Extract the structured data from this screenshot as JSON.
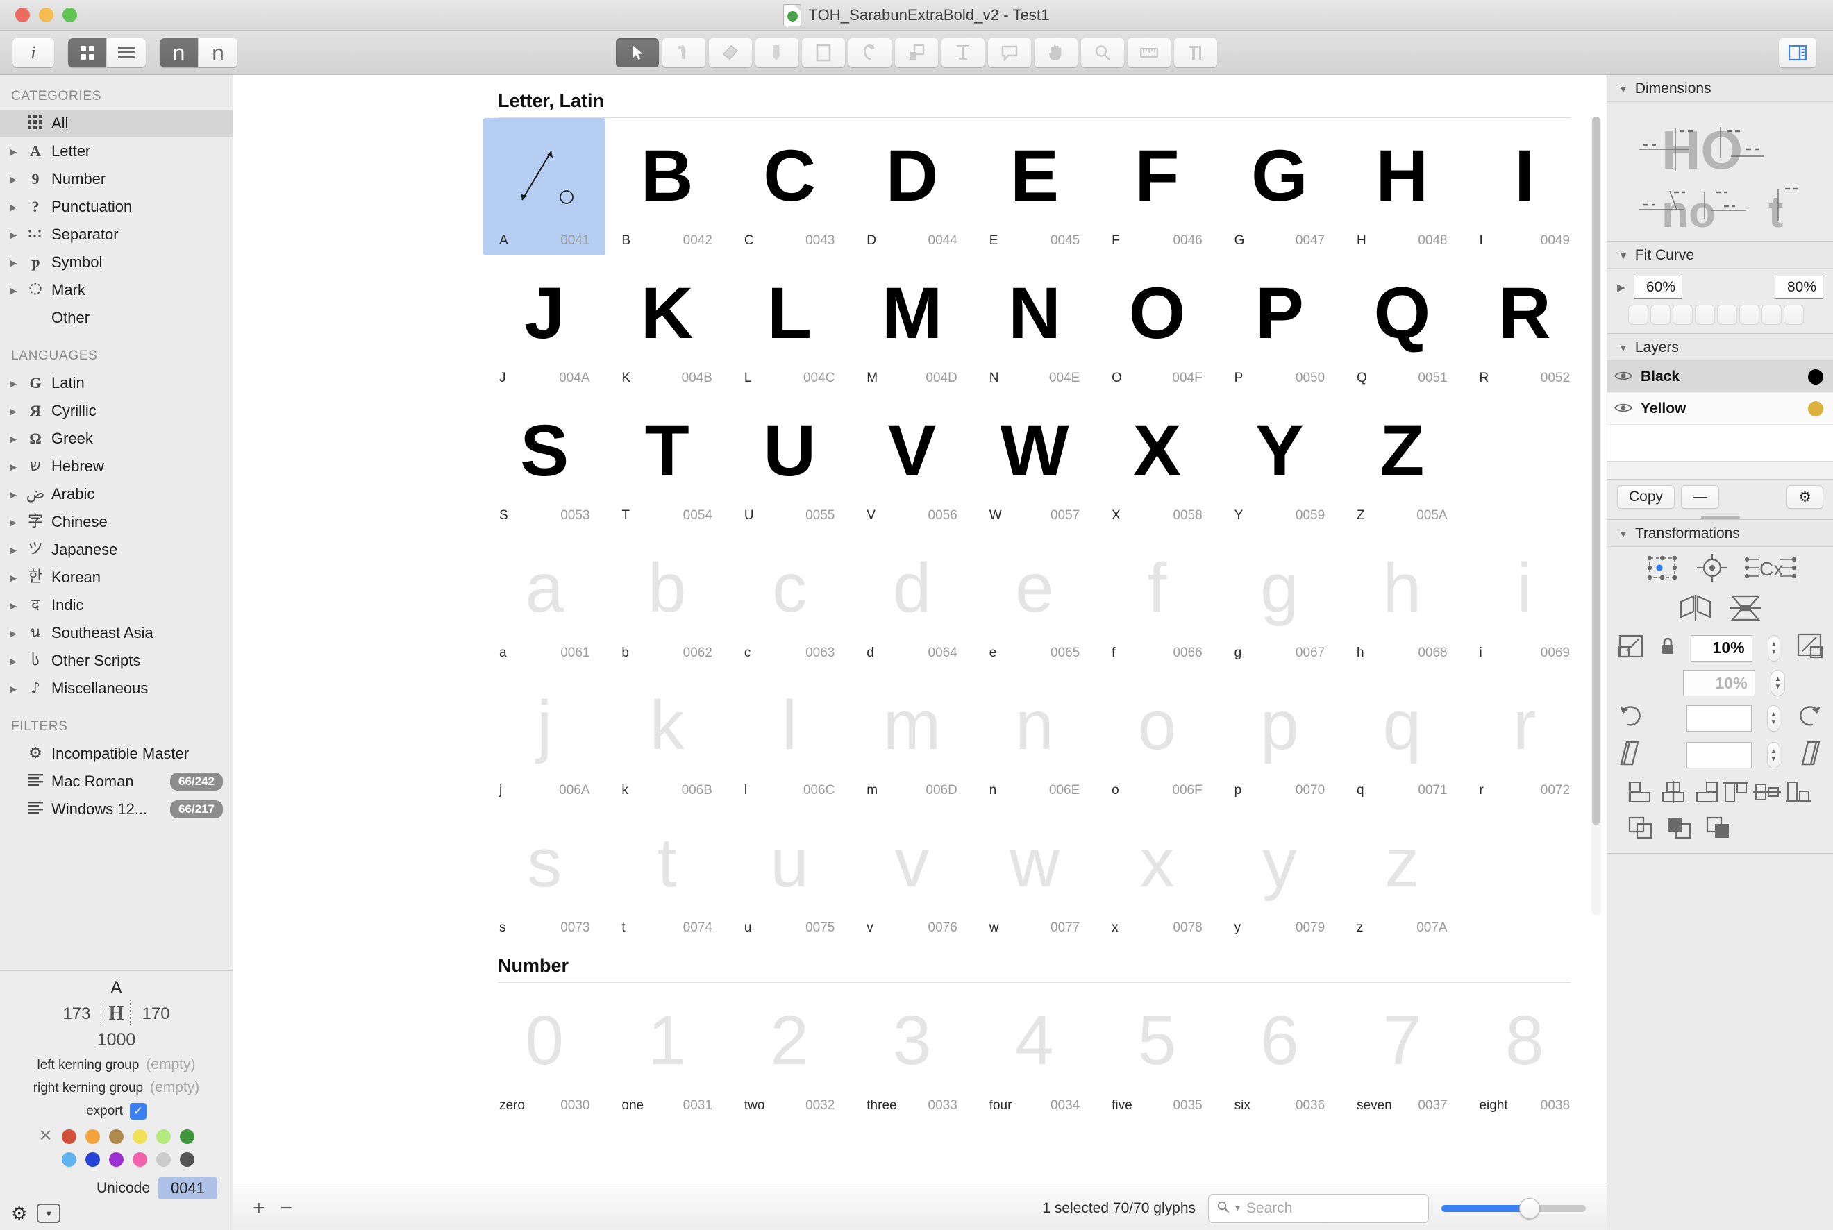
{
  "window": {
    "title": "TOH_SarabunExtraBold_v2 - Test1",
    "doc_icon": "font-document-icon"
  },
  "toolbar": {
    "info_label": "i",
    "view_grid_icon": "grid-view-icon",
    "view_list_icon": "list-view-icon",
    "font_view_label": "n",
    "text_view_label": "n",
    "tools": [
      {
        "name": "select-tool",
        "icon": "arrow-cursor-icon",
        "active": true
      },
      {
        "name": "draw-tool",
        "icon": "pen-icon",
        "active": false
      },
      {
        "name": "knife-tool",
        "icon": "knife-icon",
        "active": false
      },
      {
        "name": "pencil-tool",
        "icon": "pencil-icon",
        "active": false
      },
      {
        "name": "primitives-tool",
        "icon": "rectangle-icon",
        "active": false
      },
      {
        "name": "rotate-tool",
        "icon": "rotate-icon",
        "active": false
      },
      {
        "name": "scale-tool",
        "icon": "scale-shapes-icon",
        "active": false
      },
      {
        "name": "text-tool",
        "icon": "text-t-icon",
        "active": false
      },
      {
        "name": "annotation-tool",
        "icon": "speech-bubble-icon",
        "active": false
      },
      {
        "name": "hand-tool",
        "icon": "hand-icon",
        "active": false
      },
      {
        "name": "zoom-tool",
        "icon": "magnifier-icon",
        "active": false
      },
      {
        "name": "measurement-tool",
        "icon": "ruler-icon",
        "active": false
      },
      {
        "name": "vertical-text-tool",
        "icon": "vertical-text-icon",
        "active": false
      }
    ],
    "sidebar_toggle_icon": "inspector-toggle-icon"
  },
  "sidebar": {
    "categories_header": "CATEGORIES",
    "categories": [
      {
        "label": "All",
        "icon": "all-glyphs-icon",
        "expandable": false,
        "selected": true
      },
      {
        "label": "Letter",
        "icon": "letter-A-icon",
        "expandable": true,
        "selected": false
      },
      {
        "label": "Number",
        "icon": "number-9-icon",
        "expandable": true,
        "selected": false
      },
      {
        "label": "Punctuation",
        "icon": "question-mark-icon",
        "expandable": true,
        "selected": false
      },
      {
        "label": "Separator",
        "icon": "separator-dots-icon",
        "expandable": true,
        "selected": false
      },
      {
        "label": "Symbol",
        "icon": "pilcrow-icon",
        "expandable": true,
        "selected": false
      },
      {
        "label": "Mark",
        "icon": "dotted-circle-icon",
        "expandable": true,
        "selected": false
      },
      {
        "label": "Other",
        "icon": "",
        "expandable": false,
        "selected": false
      }
    ],
    "languages_header": "LANGUAGES",
    "languages": [
      {
        "label": "Latin",
        "icon": "latin-G-icon"
      },
      {
        "label": "Cyrillic",
        "icon": "cyrillic-ya-icon"
      },
      {
        "label": "Greek",
        "icon": "greek-omega-icon"
      },
      {
        "label": "Hebrew",
        "icon": "hebrew-shin-icon"
      },
      {
        "label": "Arabic",
        "icon": "arabic-dad-icon"
      },
      {
        "label": "Chinese",
        "icon": "chinese-zi-icon"
      },
      {
        "label": "Japanese",
        "icon": "japanese-tsu-icon"
      },
      {
        "label": "Korean",
        "icon": "korean-han-icon"
      },
      {
        "label": "Indic",
        "icon": "devanagari-de-icon"
      },
      {
        "label": "Southeast Asia",
        "icon": "thai-icon"
      },
      {
        "label": "Other Scripts",
        "icon": "other-script-icon"
      },
      {
        "label": "Miscellaneous",
        "icon": "music-note-icon"
      }
    ],
    "filters_header": "FILTERS",
    "filters": [
      {
        "label": "Incompatible Master",
        "icon": "gear-icon",
        "badge": ""
      },
      {
        "label": "Mac Roman",
        "icon": "list-lines-icon",
        "badge": "66/242"
      },
      {
        "label": "Windows 12...",
        "icon": "list-lines-icon",
        "badge": "66/217"
      }
    ]
  },
  "glyph_info": {
    "char": "A",
    "left_sidebearing": "173",
    "right_sidebearing": "170",
    "preview_letter": "H",
    "width": "1000",
    "left_kerning_label": "left kerning group",
    "left_kerning_value": "(empty)",
    "right_kerning_label": "right kerning group",
    "right_kerning_value": "(empty)",
    "export_label": "export",
    "export_checked": true,
    "check_glyph": "✓",
    "colors_row1": [
      "#d24f38",
      "#f2a33c",
      "#ae8a4c",
      "#f2e154",
      "#b5eb7e",
      "#41953a"
    ],
    "colors_row2": [
      "#5fb4f0",
      "#2743d6",
      "#9b2fd1",
      "#f062ab",
      "#cccccc",
      "#555555"
    ],
    "clear_color_icon": "x-clear-icon",
    "unicode_label": "Unicode",
    "unicode_value": "0041",
    "gear_icon": "gear-icon",
    "popup_icon": "popup-menu-icon"
  },
  "grid": {
    "sections": [
      {
        "title": "Letter, Latin",
        "rows": [
          [
            {
              "char": "A",
              "name": "A",
              "code": "0041",
              "selected": true,
              "faint": false,
              "blank": true
            },
            {
              "char": "B",
              "name": "B",
              "code": "0042",
              "selected": false,
              "faint": false
            },
            {
              "char": "C",
              "name": "C",
              "code": "0043",
              "selected": false,
              "faint": false
            },
            {
              "char": "D",
              "name": "D",
              "code": "0044",
              "selected": false,
              "faint": false
            },
            {
              "char": "E",
              "name": "E",
              "code": "0045",
              "selected": false,
              "faint": false
            },
            {
              "char": "F",
              "name": "F",
              "code": "0046",
              "selected": false,
              "faint": false
            },
            {
              "char": "G",
              "name": "G",
              "code": "0047",
              "selected": false,
              "faint": false
            },
            {
              "char": "H",
              "name": "H",
              "code": "0048",
              "selected": false,
              "faint": false
            },
            {
              "char": "I",
              "name": "I",
              "code": "0049",
              "selected": false,
              "faint": false
            }
          ],
          [
            {
              "char": "J",
              "name": "J",
              "code": "004A",
              "selected": false,
              "faint": false
            },
            {
              "char": "K",
              "name": "K",
              "code": "004B",
              "selected": false,
              "faint": false
            },
            {
              "char": "L",
              "name": "L",
              "code": "004C",
              "selected": false,
              "faint": false
            },
            {
              "char": "M",
              "name": "M",
              "code": "004D",
              "selected": false,
              "faint": false
            },
            {
              "char": "N",
              "name": "N",
              "code": "004E",
              "selected": false,
              "faint": false
            },
            {
              "char": "O",
              "name": "O",
              "code": "004F",
              "selected": false,
              "faint": false
            },
            {
              "char": "P",
              "name": "P",
              "code": "0050",
              "selected": false,
              "faint": false
            },
            {
              "char": "Q",
              "name": "Q",
              "code": "0051",
              "selected": false,
              "faint": false
            },
            {
              "char": "R",
              "name": "R",
              "code": "0052",
              "selected": false,
              "faint": false
            }
          ],
          [
            {
              "char": "S",
              "name": "S",
              "code": "0053",
              "selected": false,
              "faint": false
            },
            {
              "char": "T",
              "name": "T",
              "code": "0054",
              "selected": false,
              "faint": false
            },
            {
              "char": "U",
              "name": "U",
              "code": "0055",
              "selected": false,
              "faint": false
            },
            {
              "char": "V",
              "name": "V",
              "code": "0056",
              "selected": false,
              "faint": false
            },
            {
              "char": "W",
              "name": "W",
              "code": "0057",
              "selected": false,
              "faint": false
            },
            {
              "char": "X",
              "name": "X",
              "code": "0058",
              "selected": false,
              "faint": false
            },
            {
              "char": "Y",
              "name": "Y",
              "code": "0059",
              "selected": false,
              "faint": false
            },
            {
              "char": "Z",
              "name": "Z",
              "code": "005A",
              "selected": false,
              "faint": false
            },
            {
              "char": "",
              "name": "",
              "code": "",
              "selected": false,
              "faint": false,
              "empty": true
            }
          ],
          [
            {
              "char": "a",
              "name": "a",
              "code": "0061",
              "selected": false,
              "faint": true
            },
            {
              "char": "b",
              "name": "b",
              "code": "0062",
              "selected": false,
              "faint": true
            },
            {
              "char": "c",
              "name": "c",
              "code": "0063",
              "selected": false,
              "faint": true
            },
            {
              "char": "d",
              "name": "d",
              "code": "0064",
              "selected": false,
              "faint": true
            },
            {
              "char": "e",
              "name": "e",
              "code": "0065",
              "selected": false,
              "faint": true
            },
            {
              "char": "f",
              "name": "f",
              "code": "0066",
              "selected": false,
              "faint": true
            },
            {
              "char": "g",
              "name": "g",
              "code": "0067",
              "selected": false,
              "faint": true
            },
            {
              "char": "h",
              "name": "h",
              "code": "0068",
              "selected": false,
              "faint": true
            },
            {
              "char": "i",
              "name": "i",
              "code": "0069",
              "selected": false,
              "faint": true
            }
          ],
          [
            {
              "char": "j",
              "name": "j",
              "code": "006A",
              "selected": false,
              "faint": true
            },
            {
              "char": "k",
              "name": "k",
              "code": "006B",
              "selected": false,
              "faint": true
            },
            {
              "char": "l",
              "name": "l",
              "code": "006C",
              "selected": false,
              "faint": true
            },
            {
              "char": "m",
              "name": "m",
              "code": "006D",
              "selected": false,
              "faint": true
            },
            {
              "char": "n",
              "name": "n",
              "code": "006E",
              "selected": false,
              "faint": true
            },
            {
              "char": "o",
              "name": "o",
              "code": "006F",
              "selected": false,
              "faint": true
            },
            {
              "char": "p",
              "name": "p",
              "code": "0070",
              "selected": false,
              "faint": true
            },
            {
              "char": "q",
              "name": "q",
              "code": "0071",
              "selected": false,
              "faint": true
            },
            {
              "char": "r",
              "name": "r",
              "code": "0072",
              "selected": false,
              "faint": true
            }
          ],
          [
            {
              "char": "s",
              "name": "s",
              "code": "0073",
              "selected": false,
              "faint": true
            },
            {
              "char": "t",
              "name": "t",
              "code": "0074",
              "selected": false,
              "faint": true
            },
            {
              "char": "u",
              "name": "u",
              "code": "0075",
              "selected": false,
              "faint": true
            },
            {
              "char": "v",
              "name": "v",
              "code": "0076",
              "selected": false,
              "faint": true
            },
            {
              "char": "w",
              "name": "w",
              "code": "0077",
              "selected": false,
              "faint": true
            },
            {
              "char": "x",
              "name": "x",
              "code": "0078",
              "selected": false,
              "faint": true
            },
            {
              "char": "y",
              "name": "y",
              "code": "0079",
              "selected": false,
              "faint": true
            },
            {
              "char": "z",
              "name": "z",
              "code": "007A",
              "selected": false,
              "faint": true
            },
            {
              "char": "",
              "name": "",
              "code": "",
              "selected": false,
              "faint": false,
              "empty": true
            }
          ]
        ]
      },
      {
        "title": "Number",
        "rows": [
          [
            {
              "char": "0",
              "name": "zero",
              "code": "0030",
              "selected": false,
              "faint": true
            },
            {
              "char": "1",
              "name": "one",
              "code": "0031",
              "selected": false,
              "faint": true
            },
            {
              "char": "2",
              "name": "two",
              "code": "0032",
              "selected": false,
              "faint": true
            },
            {
              "char": "3",
              "name": "three",
              "code": "0033",
              "selected": false,
              "faint": true
            },
            {
              "char": "4",
              "name": "four",
              "code": "0034",
              "selected": false,
              "faint": true
            },
            {
              "char": "5",
              "name": "five",
              "code": "0035",
              "selected": false,
              "faint": true
            },
            {
              "char": "6",
              "name": "six",
              "code": "0036",
              "selected": false,
              "faint": true
            },
            {
              "char": "7",
              "name": "seven",
              "code": "0037",
              "selected": false,
              "faint": true
            },
            {
              "char": "8",
              "name": "eight",
              "code": "0038",
              "selected": false,
              "faint": true
            }
          ]
        ]
      }
    ]
  },
  "status": {
    "add_label": "+",
    "remove_label": "−",
    "count_text": "1 selected 70/70 glyphs",
    "search_placeholder": "Search",
    "search_value": "",
    "search_icon": "search-magnifier-icon",
    "zoom_percent": 60
  },
  "inspector": {
    "dimensions": {
      "title": "Dimensions",
      "preview_top": "HO",
      "preview_bottom_left": "no",
      "preview_bottom_right": "t"
    },
    "fit_curve": {
      "title": "Fit Curve",
      "value_left": "60%",
      "value_right": "80%",
      "preset_count": 8
    },
    "layers": {
      "title": "Layers",
      "rows": [
        {
          "name": "Black",
          "color": "#000000",
          "selected": true,
          "visible": true
        },
        {
          "name": "Yellow",
          "color": "#dcb23c",
          "selected": false,
          "visible": true
        }
      ],
      "copy_label": "Copy",
      "remove_label": "—",
      "gear_icon": "gear-icon"
    },
    "transformations": {
      "title": "Transformations",
      "scale_value": "10%",
      "scale_value_secondary": "10%",
      "rotate_value": "",
      "skew_value": "",
      "origin_icon": "transform-origin-icon",
      "align_icon": "align-center-icon",
      "metrics_icon": "metrics-Cx-icon",
      "flip_h_icon": "flip-horizontal-icon",
      "flip_v_icon": "flip-vertical-icon",
      "scale_down_icon": "scale-down-icon",
      "scale_up_icon": "scale-up-icon",
      "lock_icon": "lock-icon",
      "rotate_ccw_icon": "rotate-ccw-icon",
      "rotate_cw_icon": "rotate-cw-icon",
      "slant_left_icon": "slant-left-icon",
      "slant_right_icon": "slant-right-icon"
    }
  }
}
